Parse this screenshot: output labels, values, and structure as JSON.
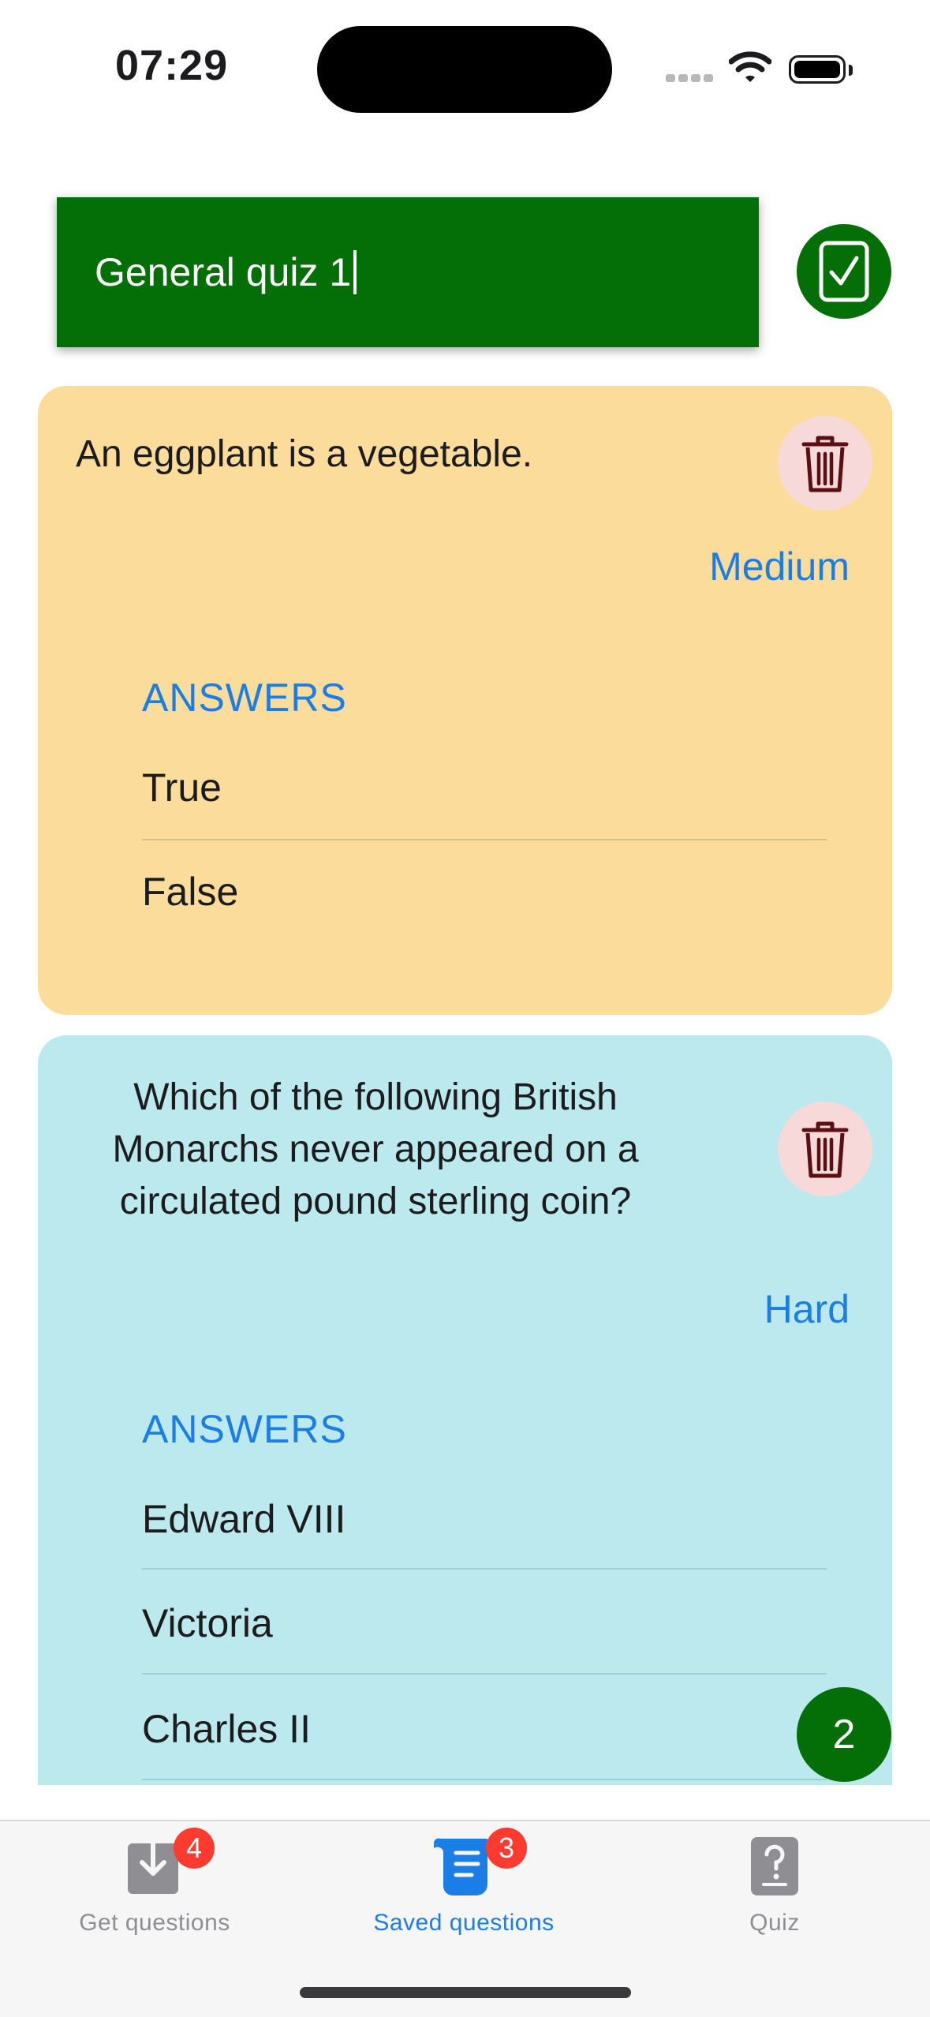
{
  "status_bar": {
    "time": "07:29"
  },
  "quiz": {
    "name": "General quiz 1"
  },
  "cards": [
    {
      "question": "An eggplant is a vegetable.",
      "difficulty": "Medium",
      "answers_heading": "ANSWERS",
      "answers": [
        "True",
        "False"
      ],
      "color": "#fcdc9a"
    },
    {
      "question": "Which of the following  British Monarchs never appeared on a circulated pound sterling coin?",
      "difficulty": "Hard",
      "answers_heading": "ANSWERS",
      "answers": [
        "Edward VIII",
        "Victoria",
        "Charles II"
      ],
      "color": "#bbe9ee"
    }
  ],
  "question_count": "2",
  "tabs": [
    {
      "label": "Get questions",
      "icon": "download-icon",
      "badge": "4",
      "selected": false
    },
    {
      "label": "Saved questions",
      "icon": "scroll-icon",
      "badge": "3",
      "selected": true
    },
    {
      "label": "Quiz",
      "icon": "question-icon",
      "badge": "",
      "selected": false
    }
  ],
  "colors": {
    "accent_green": "#046f06",
    "link_blue": "#1b7ee6",
    "badge_red": "#ff3b30",
    "tab_inactive": "#8e8e93"
  }
}
